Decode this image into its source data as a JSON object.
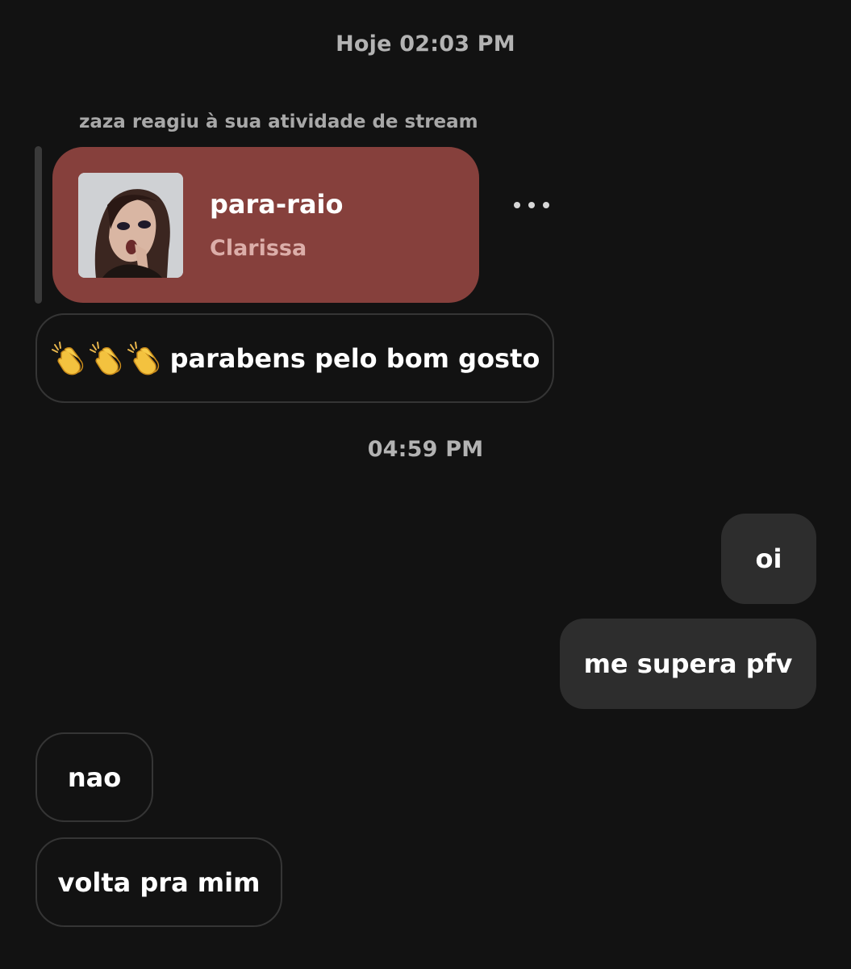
{
  "timestamps": {
    "first": "Hoje 02:03 PM",
    "second": "04:59 PM"
  },
  "stream_reaction": {
    "label": "zaza reagiu à sua atividade de stream",
    "card": {
      "title": "para-raio",
      "artist": "Clarissa",
      "background_color": "#86403c",
      "album_art": "album-cover-portrait"
    },
    "more_icon": "more-options-icon"
  },
  "messages": [
    {
      "direction": "received",
      "emoji": [
        "clapping-hands-icon",
        "clapping-hands-icon",
        "clapping-hands-icon"
      ],
      "text": "parabens pelo bom gosto"
    },
    {
      "direction": "sent",
      "text": "oi"
    },
    {
      "direction": "sent",
      "text": "me supera pfv"
    },
    {
      "direction": "received",
      "text": "nao"
    },
    {
      "direction": "received",
      "text": "volta pra mim"
    }
  ],
  "colors": {
    "background": "#121212",
    "sent_bubble": "#2d2d2d",
    "received_border": "#353535",
    "timestamp": "#b3b3b3",
    "artist_text": "#dcaea9"
  }
}
